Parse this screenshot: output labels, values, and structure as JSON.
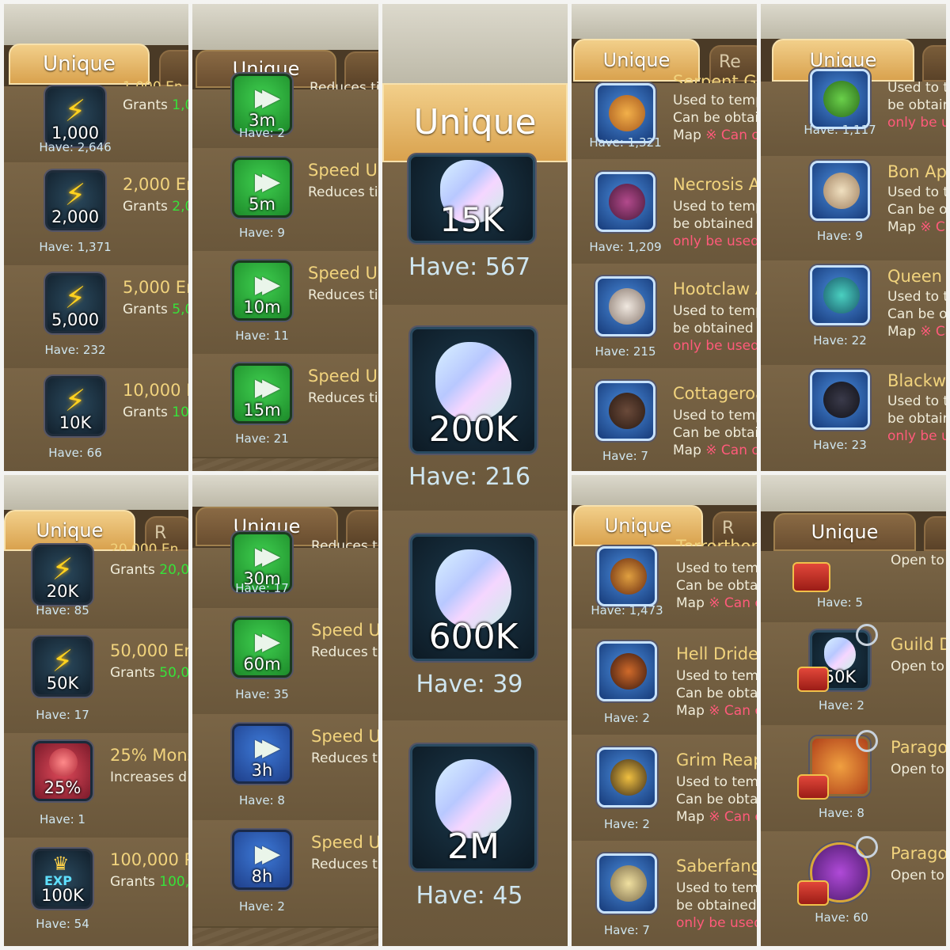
{
  "tab_label": "Unique",
  "tab_partial_r": "R",
  "tab_partial_re": "Re",
  "panel1": {
    "top_partial": "1,000 En",
    "items": [
      {
        "icon_label": "1,000",
        "title": "",
        "grants": "Grants ",
        "grants_val": "1,0",
        "have": "Have: 2,646"
      },
      {
        "icon_label": "2,000",
        "title": "2,000 Ene",
        "grants": "Grants ",
        "grants_val": "2,0",
        "have": "Have: 1,371"
      },
      {
        "icon_label": "5,000",
        "title": "5,000 Ene",
        "grants": "Grants ",
        "grants_val": "5,0",
        "have": "Have: 232"
      },
      {
        "icon_label": "10K",
        "title": "10,000 En",
        "grants": "Grants ",
        "grants_val": "10",
        "have": "Have: 66"
      }
    ]
  },
  "panel2": {
    "top_partial": "Reduces ti",
    "items": [
      {
        "icon_label": "3m",
        "title": "",
        "desc": "",
        "have": "Have: 2"
      },
      {
        "icon_label": "5m",
        "title": "Speed Up",
        "desc": "Reduces ti",
        "have": "Have: 9"
      },
      {
        "icon_label": "10m",
        "title": "Speed Up",
        "desc": "Reduces ti",
        "have": "Have: 11"
      },
      {
        "icon_label": "15m",
        "title": "Speed Up",
        "desc": "Reduces ti",
        "have": "Have: 21"
      }
    ]
  },
  "panel3": {
    "items": [
      {
        "icon_label": "15K",
        "have": "Have: 567"
      },
      {
        "icon_label": "200K",
        "have": "Have: 216"
      },
      {
        "icon_label": "600K",
        "have": "Have: 39"
      },
      {
        "icon_label": "2M",
        "have": "Have: 45"
      }
    ]
  },
  "panel4": {
    "items": [
      {
        "title": "Serpent Gi",
        "l1": "Used to tempe",
        "l2": "Can be obtain",
        "l3a": "Map ",
        "l3b": "※ Can on",
        "have": "Have: 1,321"
      },
      {
        "title": "Necrosis A",
        "l1": "Used to temp",
        "l2": "be obtained f",
        "l3a": "",
        "l3b": "only be used",
        "have": "Have: 1,209"
      },
      {
        "title": "Hootclaw A",
        "l1": "Used to temp",
        "l2": "be obtained f",
        "l3a": "",
        "l3b": "only be used",
        "have": "Have: 215"
      },
      {
        "title": "Cottageroa",
        "l1": "Used to temp",
        "l2": "Can be obtain",
        "l3a": "Map ",
        "l3b": "※ Can o",
        "have": "Have: 7"
      }
    ]
  },
  "panel5": {
    "items": [
      {
        "title": "",
        "l1": "Used to te",
        "l2": "be obtain",
        "l3a": "",
        "l3b": "only be u",
        "have": "Have: 1,117"
      },
      {
        "title": "Bon App",
        "l1": "Used to te",
        "l2": "Can be ob",
        "l3a": "Map ",
        "l3b": "※ C",
        "have": "Have: 9"
      },
      {
        "title": "Queen I",
        "l1": "Used to te",
        "l2": "Can be ob",
        "l3a": "Map ",
        "l3b": "※ Ca",
        "have": "Have: 22"
      },
      {
        "title": "Blackwi",
        "l1": "Used to te",
        "l2": "be obtain",
        "l3a": "",
        "l3b": "only be u",
        "have": "Have: 23"
      }
    ]
  },
  "panel6": {
    "items": [
      {
        "icon_label": "20K",
        "title": "20,000 En",
        "grants": "Grants ",
        "grants_val": "20,0",
        "have": "Have: 85"
      },
      {
        "icon_label": "50K",
        "title": "50,000 Ene",
        "grants": "Grants ",
        "grants_val": "50,0",
        "have": "Have: 17"
      },
      {
        "icon_label": "25%",
        "title": "25% Mons",
        "desc": "Increases d",
        "have": "Have: 1"
      },
      {
        "icon_label": "100K",
        "title": "100,000 Pl",
        "grants": "Grants ",
        "grants_val": "100,",
        "have": "Have: 54"
      }
    ]
  },
  "panel7": {
    "items": [
      {
        "icon_label": "30m",
        "title": "",
        "desc": "Reduces t",
        "have": "Have: 17"
      },
      {
        "icon_label": "60m",
        "title": "Speed U",
        "desc": "Reduces t",
        "have": "Have: 35"
      },
      {
        "icon_label": "3h",
        "title": "Speed U",
        "desc": "Reduces t",
        "have": "Have: 8"
      },
      {
        "icon_label": "8h",
        "title": "Speed U",
        "desc": "Reduces t",
        "have": "Have: 2"
      }
    ]
  },
  "panel8": {
    "items": [
      {
        "title": "Terrorthor",
        "l1": "Used to temp",
        "l2": "Can be obtai",
        "l3a": "Map ",
        "l3b": "※ Can c",
        "have": "Have: 1,473"
      },
      {
        "title": "Hell Drider",
        "l1": "Used to temp",
        "l2": "Can be obtai",
        "l3a": "Map ",
        "l3b": "※ Can c",
        "have": "Have: 2"
      },
      {
        "title": "Grim Reap",
        "l1": "Used to temp",
        "l2": "Can be obtai",
        "l3a": "Map ",
        "l3b": "※ Can c",
        "have": "Have: 2"
      },
      {
        "title": "Saberfang",
        "l1": "Used to temp",
        "l2": "be obtained f",
        "l3a": "",
        "l3b": "only be used",
        "have": "Have: 7"
      }
    ]
  },
  "panel9": {
    "items": [
      {
        "title": "",
        "desc": "Open to",
        "icon_label": "",
        "have": "Have: 5"
      },
      {
        "title": "Guild D",
        "desc": "Open to",
        "icon_label": "50K",
        "have": "Have: 2"
      },
      {
        "title": "Parago",
        "desc": "Open to",
        "icon_label": "",
        "have": "Have: 8"
      },
      {
        "title": "Parago",
        "desc": "Open to",
        "icon_label": "",
        "have": "Have: 60"
      }
    ]
  },
  "colors": {
    "tab_gold": "#e6b866",
    "grants_green": "#37e23a",
    "warn_red": "#ff5a7a",
    "title_gold": "#f1d37d"
  }
}
